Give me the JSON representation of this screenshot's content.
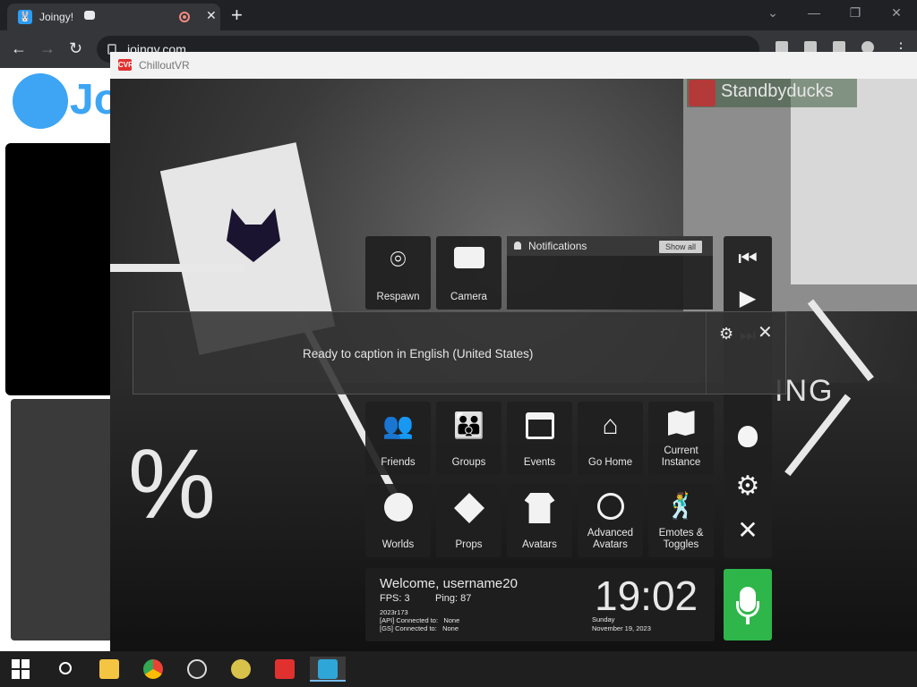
{
  "browser": {
    "tab_title": "Joingy!",
    "tab_close": "✕",
    "new_tab": "+",
    "url": "joingy.com",
    "window_controls": {
      "minimize": "—",
      "restore": "❐",
      "close": "✕",
      "tab_search": "⌄"
    },
    "nav": {
      "back": "←",
      "forward": "→",
      "reload": "↻"
    }
  },
  "site": {
    "logo_text": "Jo"
  },
  "cvr_window": {
    "title": "ChilloutVR",
    "title_icon": "CVR"
  },
  "scene": {
    "player_name": "Standbyducks",
    "percent_text": "%",
    "loading_fragment": "ING"
  },
  "quick_menu": {
    "top_tiles": [
      {
        "label": "Respawn",
        "icon": "pin-icon"
      },
      {
        "label": "Camera",
        "icon": "camera-icon"
      }
    ],
    "notifications": {
      "title": "Notifications",
      "show_all": "Show all"
    },
    "row1": [
      {
        "label": "Friends",
        "icon": "friends-icon"
      },
      {
        "label": "Groups",
        "icon": "groups-icon"
      },
      {
        "label": "Events",
        "icon": "calendar-icon"
      },
      {
        "label": "Go Home",
        "icon": "home-icon"
      },
      {
        "label": "Current Instance",
        "icon": "map-icon"
      }
    ],
    "row2": [
      {
        "label": "Worlds",
        "icon": "globe-icon"
      },
      {
        "label": "Props",
        "icon": "cube-icon"
      },
      {
        "label": "Avatars",
        "icon": "shirt-icon"
      },
      {
        "label": "Advanced Avatars",
        "icon": "potion-icon"
      },
      {
        "label": "Emotes & Toggles",
        "icon": "dance-icon"
      }
    ],
    "sidebar": {
      "prev": "⏮",
      "play": "▶",
      "next": "⏭",
      "bug": "bug-icon",
      "settings": "⚙",
      "close": "✕"
    },
    "status": {
      "welcome": "Welcome, username20",
      "fps_label": "FPS:",
      "fps_value": "3",
      "ping_label": "Ping:",
      "ping_value": "87",
      "build": "2023r173",
      "api_label": "[API] Connected to:",
      "api_value": "None",
      "gs_label": "[GS] Connected to:",
      "gs_value": "None",
      "time": "19:02",
      "day": "Sunday",
      "date": "November 19, 2023"
    }
  },
  "caption": {
    "text": "Ready to caption in English (United States)",
    "settings": "⚙",
    "close": "✕"
  },
  "colors": {
    "accent_green": "#2fb64a",
    "joingy_blue": "#3da5f4",
    "cvr_red": "#e0312f"
  }
}
